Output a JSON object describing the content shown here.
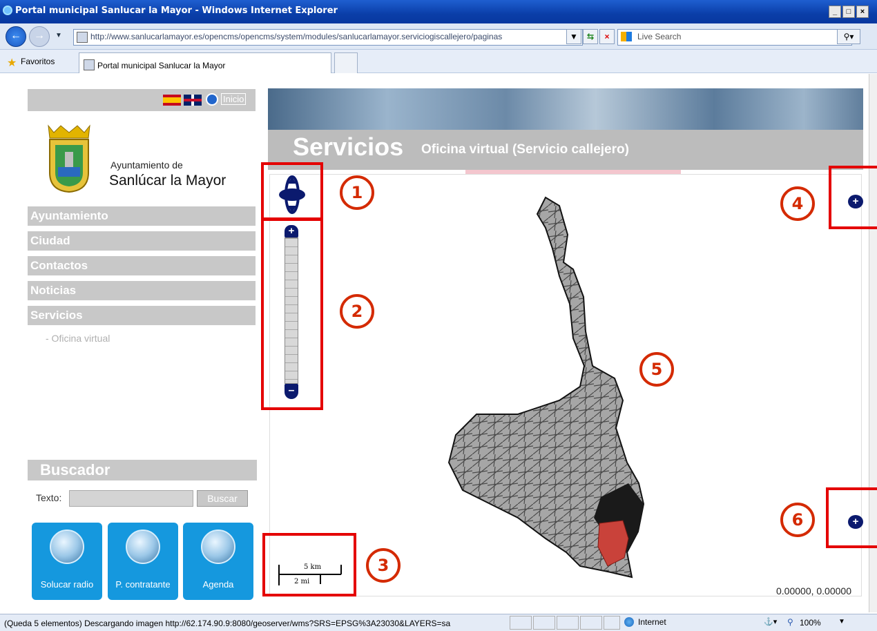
{
  "window": {
    "title": "Portal municipal Sanlucar la Mayor - Windows Internet Explorer",
    "min": "_",
    "max": "□",
    "close": "×"
  },
  "browser": {
    "url": "http://www.sanlucarlamayor.es/opencms/opencms/system/modules/sanlucarlamayor.serviciogiscallejero/paginas",
    "search_placeholder": "Live Search",
    "favorites_label": "Favoritos",
    "tab_title": "Portal municipal Sanlucar la Mayor"
  },
  "site": {
    "home_label": "Inicio",
    "ayto_label": "Ayuntamiento de",
    "ayto_name": "Sanlúcar la Mayor",
    "menu": [
      "Ayuntamiento",
      "Ciudad",
      "Contactos",
      "Noticias",
      "Servicios"
    ],
    "submenu": "- Oficina virtual",
    "buscador": {
      "title": "Buscador",
      "texto_label": "Texto:",
      "button": "Buscar"
    },
    "apps": [
      "Solucar radio",
      "P. contratante",
      "Agenda"
    ]
  },
  "header": {
    "title": "Servicios",
    "subtitle": "Oficina virtual (Servicio callejero)"
  },
  "map": {
    "scale_km": "5 km",
    "scale_mi": "2 mi",
    "coords": "0.00000, 0.00000",
    "zoom_in": "+",
    "zoom_out": "–",
    "layer_plus": "+"
  },
  "annotations": [
    "1",
    "2",
    "3",
    "4",
    "5",
    "6"
  ],
  "statusbar": {
    "text": "(Queda 5 elementos) Descargando imagen http://62.174.90.9:8080/geoserver/wms?SRS=EPSG%3A23030&LAYERS=sa",
    "zone": "Internet",
    "zoom": "100%"
  },
  "colors": {
    "annotation_red": "#e40000",
    "control_navy": "#0b1a6e",
    "map_fill": "#a6a6a6",
    "highlight": "#c0392b"
  }
}
